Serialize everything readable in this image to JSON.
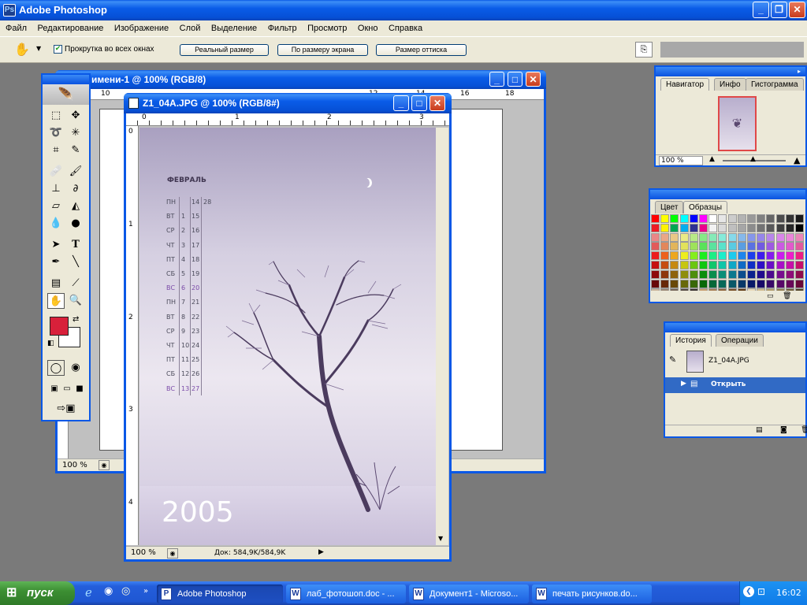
{
  "app": {
    "title": "Adobe Photoshop"
  },
  "menu": [
    "Файл",
    "Редактирование",
    "Изображение",
    "Слой",
    "Выделение",
    "Фильтр",
    "Просмотр",
    "Окно",
    "Справка"
  ],
  "options": {
    "scroll_all_label": "Прокрутка во всех окнах",
    "scroll_all_checked": true,
    "buttons": [
      "Реальный размер",
      "По размеру экрана",
      "Размер оттиска"
    ]
  },
  "back_doc": {
    "title": "имени-1 @ 100% (RGB/8)",
    "zoom": "100 %",
    "ruler": [
      "10",
      "12",
      "14",
      "16",
      "18"
    ]
  },
  "front_doc": {
    "title": "Z1_04A.JPG @ 100% (RGB/8#)",
    "zoom": "100 %",
    "status": "Док: 584,9K/584,9K",
    "ruler_h": [
      "0",
      "1",
      "2",
      "3"
    ],
    "ruler_v": [
      "0",
      "1",
      "2",
      "3",
      "4"
    ]
  },
  "calendar": {
    "month": "ФЕВРАЛЬ",
    "year": "2005",
    "rows": [
      [
        "ПН",
        "",
        "14",
        "28"
      ],
      [
        "ВТ",
        "1",
        "15",
        ""
      ],
      [
        "СР",
        "2",
        "16",
        ""
      ],
      [
        "ЧТ",
        "3",
        "17",
        ""
      ],
      [
        "ПТ",
        "4",
        "18",
        ""
      ],
      [
        "СБ",
        "5",
        "19",
        ""
      ],
      [
        "ВС",
        "6",
        "20",
        ""
      ],
      [
        "ПН",
        "7",
        "21",
        ""
      ],
      [
        "ВТ",
        "8",
        "22",
        ""
      ],
      [
        "СР",
        "9",
        "23",
        ""
      ],
      [
        "ЧТ",
        "10",
        "24",
        ""
      ],
      [
        "ПТ",
        "11",
        "25",
        ""
      ],
      [
        "СБ",
        "12",
        "26",
        ""
      ],
      [
        "ВС",
        "13",
        "27",
        ""
      ]
    ],
    "sunday_color": "#7a4aa8"
  },
  "navigator": {
    "tabs": [
      "Навигатор",
      "Инфо",
      "Гистограмма"
    ],
    "zoom": "100 %"
  },
  "swatches": {
    "tabs": [
      "Цвет",
      "Образцы"
    ]
  },
  "history": {
    "tabs": [
      "История",
      "Операции"
    ],
    "snapshot": "Z1_04A.JPG",
    "item": "Открыть"
  },
  "taskbar": {
    "start": "пуск",
    "tasks": [
      "Adobe Photoshop",
      "лаб_фотошоп.doc - ...",
      "Документ1 - Microso...",
      "печать рисунков.do..."
    ],
    "clock": "16:02"
  },
  "colors": {
    "foreground": "#d8203a",
    "background": "#ffffff",
    "titlebar": "#0a58e6"
  }
}
